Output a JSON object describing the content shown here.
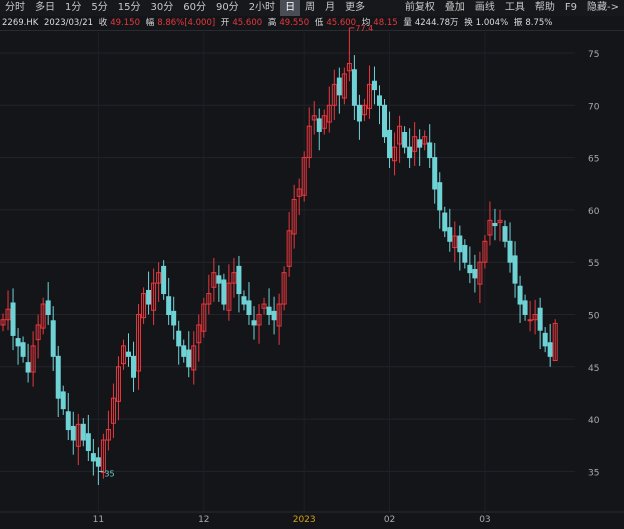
{
  "toolbar": {
    "left": [
      "分时",
      "多日",
      "1分",
      "5分",
      "15分",
      "30分",
      "60分",
      "90分",
      "2小时",
      "日",
      "周",
      "月",
      "更多"
    ],
    "active": "日",
    "right": [
      "前复权",
      "叠加",
      "画线",
      "工具",
      "帮助",
      "F9",
      "隐藏->"
    ]
  },
  "info": {
    "symbol": "2269.HK",
    "date": "2023/03/21",
    "close_label": "收",
    "close": "49.150",
    "change_label": "幅",
    "change": "8.86%[4.000]",
    "open_label": "开",
    "open": "45.600",
    "high_label": "高",
    "high": "49.550",
    "low_label": "低",
    "low": "45.600",
    "avg_label": "均",
    "avg": "48.15",
    "volume_label": "量",
    "volume": "4244.78万",
    "turnover_label": "换",
    "turnover": "1.004%",
    "amplitude_label": "振",
    "amplitude": "8.75%"
  },
  "colors": {
    "up": "#e8383d",
    "down": "#6fd3d6",
    "background": "#141519",
    "year_label": "#d4a017"
  },
  "chart_data": {
    "type": "candlestick",
    "yticks": [
      75,
      70,
      65,
      60,
      55,
      50,
      45,
      40,
      35
    ],
    "ylim": [
      33.5,
      77.8
    ],
    "xticks": [
      {
        "label": "11",
        "index": 19
      },
      {
        "label": "12",
        "index": 40
      },
      {
        "label": "2023",
        "index": 60,
        "highlight": true
      },
      {
        "label": "02",
        "index": 77
      },
      {
        "label": "03",
        "index": 96
      }
    ],
    "closes": [
      49.5,
      50.5,
      48,
      47,
      46,
      44.5,
      47,
      49,
      51,
      50,
      46,
      42,
      41,
      39,
      38,
      39.5,
      38,
      37,
      36,
      35.5,
      38,
      39,
      42,
      45,
      47,
      46,
      44,
      50,
      52,
      51,
      53,
      54,
      52,
      50,
      49,
      47,
      46,
      45,
      47,
      49,
      51,
      52,
      54,
      53,
      51,
      53,
      54,
      52,
      51,
      50,
      49,
      50,
      51,
      50,
      49.5,
      51,
      54,
      58,
      61,
      62,
      65,
      68,
      69,
      67.5,
      69,
      70,
      72,
      71,
      73,
      74,
      70,
      68.5,
      70,
      72,
      71.5,
      70,
      67,
      65,
      66,
      68,
      66,
      65,
      67,
      66,
      67,
      65,
      62,
      60,
      58,
      57,
      57.5,
      56,
      55,
      54,
      53.5,
      55,
      57,
      59,
      58.5,
      59,
      57,
      55,
      53,
      51,
      50,
      49.5,
      50,
      48.5,
      47,
      46
    ],
    "last_candle": {
      "open": 45.6,
      "high": 49.55,
      "low": 45.6,
      "close": 49.15
    },
    "annotations": [
      {
        "label": "77.4",
        "index": 69,
        "value": 77.4
      },
      {
        "label": "35",
        "index": 19,
        "value": 35
      }
    ]
  }
}
